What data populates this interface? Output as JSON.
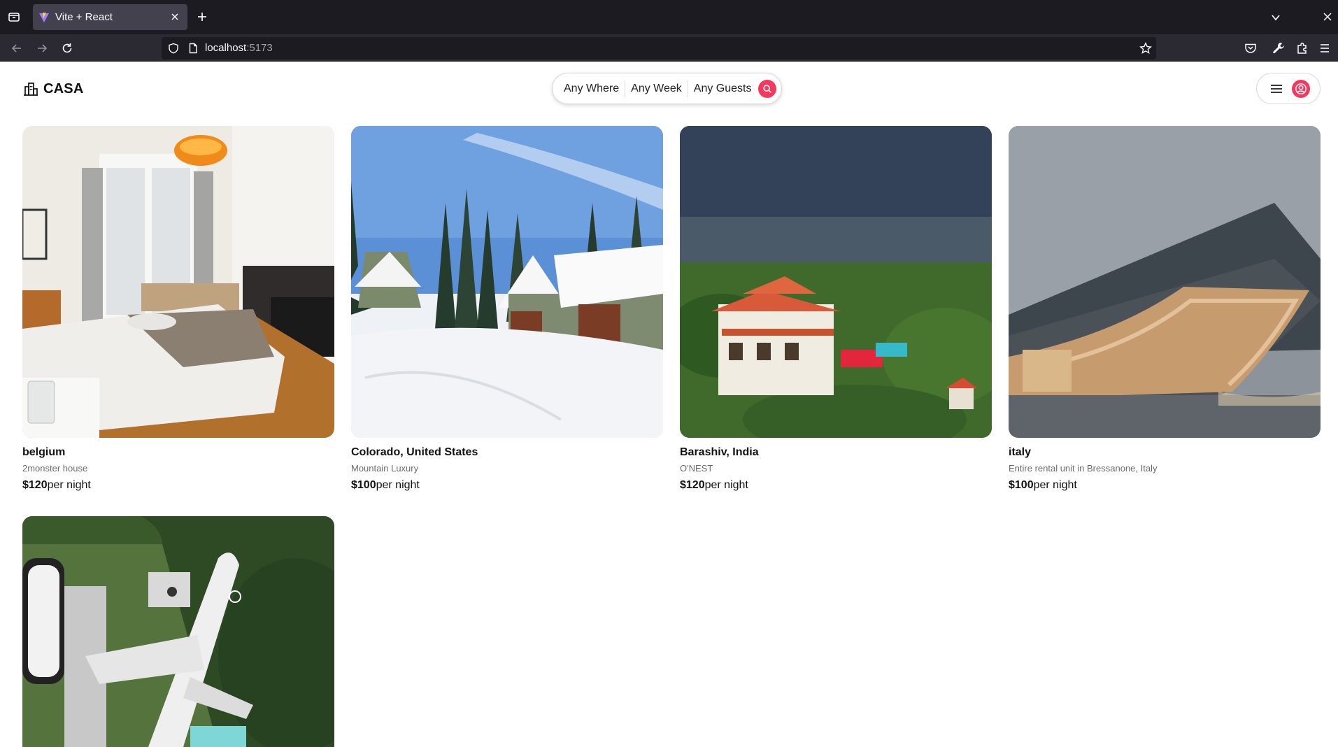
{
  "browser": {
    "tab_title": "Vite + React",
    "url_host": "localhost",
    "url_port": ":5173"
  },
  "header": {
    "logo_text": "CASA",
    "search": {
      "where": "Any Where",
      "week": "Any Week",
      "guests": "Any Guests"
    }
  },
  "listings": [
    {
      "title": "belgium",
      "subtitle": "2monster house",
      "price": "$120",
      "price_unit": "per night"
    },
    {
      "title": "Colorado, United States",
      "subtitle": "Mountain Luxury",
      "price": "$100",
      "price_unit": "per night"
    },
    {
      "title": "Barashiv, India",
      "subtitle": "O'NEST",
      "price": "$120",
      "price_unit": "per night"
    },
    {
      "title": "italy",
      "subtitle": "Entire rental unit in Bressanone, Italy",
      "price": "$100",
      "price_unit": "per night"
    }
  ],
  "colors": {
    "accent": "#f5385d",
    "chrome_dark": "#1c1b22",
    "chrome_toolbar": "#2b2a33"
  },
  "icons": [
    "tab-list-icon",
    "close-icon",
    "plus-icon",
    "chevron-down-icon",
    "back-icon",
    "forward-icon",
    "reload-icon",
    "shield-icon",
    "page-icon",
    "star-icon",
    "pocket-icon",
    "wrench-icon",
    "extensions-icon",
    "app-menu-icon",
    "logo-building-icon",
    "search-icon",
    "hamburger-icon",
    "user-icon"
  ]
}
